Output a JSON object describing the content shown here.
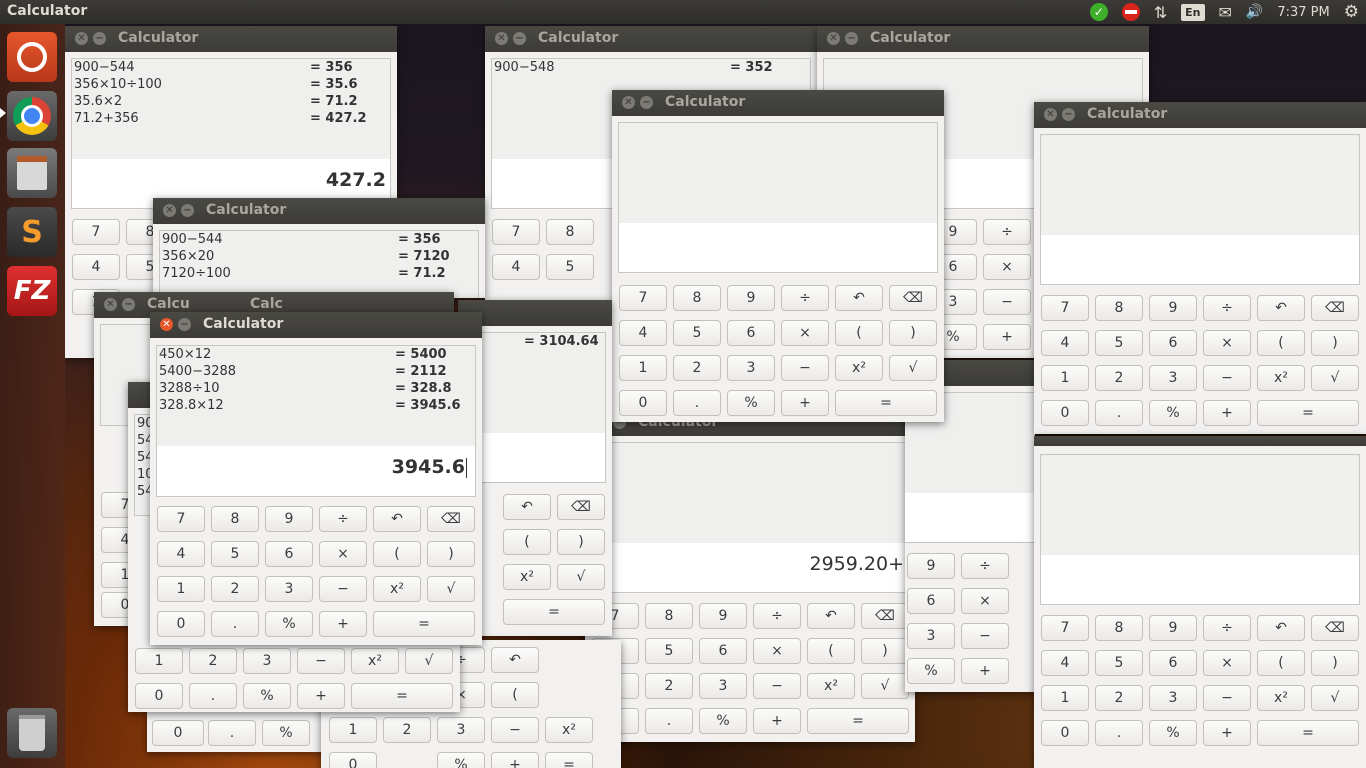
{
  "topbar": {
    "app_title": "Calculator",
    "language": "En",
    "time": "7:37 PM"
  },
  "icons": {
    "updates": "check-icon",
    "no_network": "no-entry-icon",
    "transfer": "arrows-icon",
    "mail": "mail-icon",
    "volume": "volume-icon",
    "settings": "gear-icon"
  },
  "launcher": {
    "items": [
      "ubuntu-dash",
      "chrome",
      "files",
      "sublime-text",
      "filezilla",
      "trash"
    ],
    "fz_label": "FZ",
    "sublime_label": "S"
  },
  "calc": {
    "window_title": "Calculator",
    "keys": {
      "k7": "7",
      "k8": "8",
      "k9": "9",
      "div": "÷",
      "undo": "↶",
      "back": "⌫",
      "k4": "4",
      "k5": "5",
      "k6": "6",
      "mul": "×",
      "lp": "(",
      "rp": ")",
      "k1": "1",
      "k2": "2",
      "k3": "3",
      "sub": "−",
      "sq": "x²",
      "sqrt": "√",
      "k0": "0",
      "dot": ".",
      "pct": "%",
      "add": "+",
      "eq": "="
    }
  },
  "win_a": {
    "history": [
      {
        "expr": "900−544",
        "result": "= 356"
      },
      {
        "expr": "356×10÷100",
        "result": "= 35.6"
      },
      {
        "expr": "35.6×2",
        "result": "= 71.2"
      },
      {
        "expr": "71.2+356",
        "result": "= 427.2"
      }
    ],
    "display": "427.2"
  },
  "win_b": {
    "history": [
      {
        "expr": "900−548",
        "result": "= 352"
      }
    ]
  },
  "win_d": {
    "history": [
      {
        "expr": "900−544",
        "result": "= 356"
      },
      {
        "expr": "356×20",
        "result": "= 7120"
      },
      {
        "expr": "7120÷100",
        "result": "= 71.2"
      }
    ]
  },
  "win_e": {
    "history_result": "= 3104.64"
  },
  "win_h": {
    "display": "2959.20+"
  },
  "win_main": {
    "history": [
      {
        "expr": "450×12",
        "result": "= 5400"
      },
      {
        "expr": "5400−3288",
        "result": "= 2112"
      },
      {
        "expr": "3288÷10",
        "result": "= 328.8"
      },
      {
        "expr": "328.8×12",
        "result": "= 3945.6"
      }
    ],
    "display": "3945.6"
  },
  "partial": {
    "win_f_title": "Calcu",
    "win_g_title": "Calc",
    "win_stack_hist": [
      "90",
      "54",
      "54",
      "10",
      "54"
    ]
  }
}
